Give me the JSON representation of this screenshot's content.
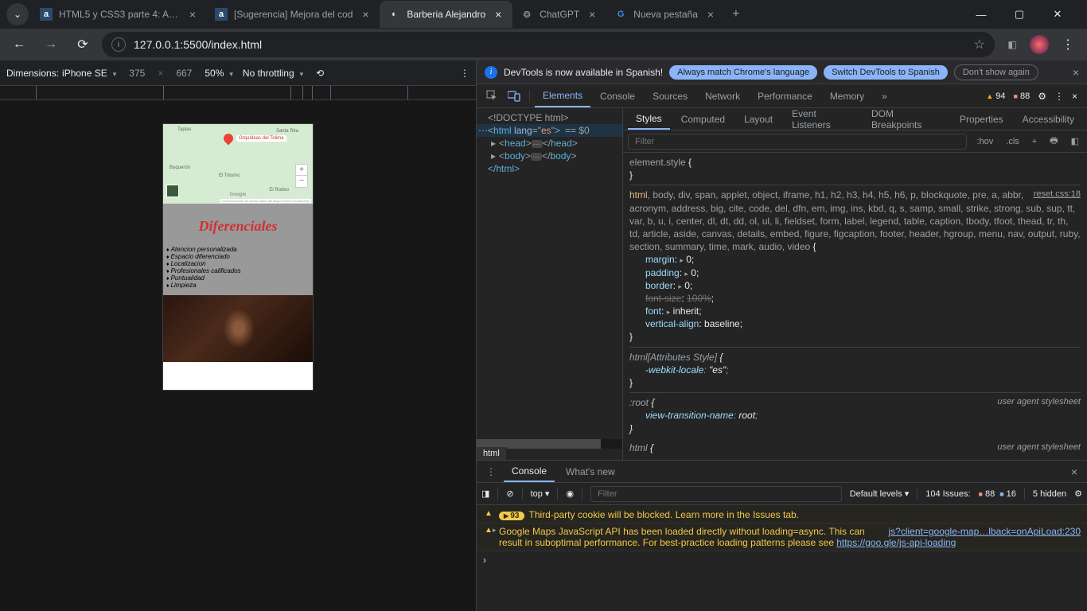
{
  "tabs": [
    {
      "title": "HTML5 y CSS3 parte 4: Avan",
      "favicon": "a"
    },
    {
      "title": "[Sugerencia] Mejora del cod",
      "favicon": "a"
    },
    {
      "title": "Barberia Alejandro",
      "favicon": "◐",
      "active": true
    },
    {
      "title": "ChatGPT",
      "favicon": "❂"
    },
    {
      "title": "Nueva pestaña",
      "favicon": "G"
    }
  ],
  "address": {
    "url": "127.0.0.1:5500/index.html"
  },
  "deviceBar": {
    "dimensions_label": "Dimensions:",
    "device": "iPhone SE",
    "width": "375",
    "height": "667",
    "zoom": "50%",
    "throttling": "No throttling"
  },
  "page": {
    "map": {
      "pin_label": "Orquídeas del Tolima",
      "labels": [
        "Tapias",
        "Santa Rita",
        "Boquerón",
        "El Totumo",
        "El Rodeo"
      ],
      "logo": "Google",
      "attrib": "Combinaciones de teclas   Datos del mapa ©2024   Condiciones"
    },
    "section_title": "Diferenciales",
    "items": [
      "Atencion personalizada",
      "Espacio diferenciado",
      "Localizacion",
      "Profesionales calificados",
      "Puntualidad",
      "Limpieza"
    ]
  },
  "infobar": {
    "text": "DevTools is now available in Spanish!",
    "btn1": "Always match Chrome's language",
    "btn2": "Switch DevTools to Spanish",
    "btn3": "Don't show again"
  },
  "dtTabs": [
    "Elements",
    "Console",
    "Sources",
    "Network",
    "Performance",
    "Memory"
  ],
  "dtBadges": {
    "warn": "94",
    "err": "88"
  },
  "elements": {
    "doctype": "<!DOCTYPE html>",
    "html_open": "html",
    "lang_attr": "lang",
    "lang_val": "es",
    "eq": "== $0",
    "head": "head",
    "body": "body",
    "html_close": "</html>",
    "crumb": "html"
  },
  "stylesTabs": [
    "Styles",
    "Computed",
    "Layout",
    "Event Listeners",
    "DOM Breakpoints",
    "Properties",
    "Accessibility"
  ],
  "stylesToolbar": {
    "filter_ph": "Filter",
    "hov": ":hov",
    "cls": ".cls"
  },
  "styles": {
    "r0": {
      "sel": "element.style"
    },
    "r1": {
      "src": "reset.css:18",
      "selectors": "html, body, div, span, applet, object, iframe, h1, h2, h3, h4, h5, h6, p, blockquote, pre, a, abbr, acronym, address, big, cite, code, del, dfn, em, img, ins, kbd, q, s, samp, small, strike, strong, sub, sup, tt, var, b, u, i, center, dl, dt, dd, ol, ul, li, fieldset, form, label, legend, table, caption, tbody, tfoot, thead, tr, th, td, article, aside, canvas, details, embed, figure, figcaption, footer, header, hgroup, menu, nav, output, ruby, section, summary, time, mark, audio, video",
      "props": [
        {
          "n": "margin",
          "v": "0",
          "tri": true
        },
        {
          "n": "padding",
          "v": "0",
          "tri": true
        },
        {
          "n": "border",
          "v": "0",
          "tri": true
        },
        {
          "n": "font-size",
          "v": "100%",
          "struck": true
        },
        {
          "n": "font",
          "v": "inherit",
          "tri": true
        },
        {
          "n": "vertical-align",
          "v": "baseline"
        }
      ]
    },
    "r2": {
      "sel": "html[Attributes Style]",
      "props": [
        {
          "n": "-webkit-locale",
          "v": "\"es\""
        }
      ]
    },
    "r3": {
      "sel": ":root",
      "src": "user agent stylesheet",
      "props": [
        {
          "n": "view-transition-name",
          "v": "root"
        }
      ]
    },
    "r4": {
      "sel": "html",
      "src": "user agent stylesheet"
    }
  },
  "drawerTabs": [
    "Console",
    "What's new"
  ],
  "consoleToolbar": {
    "context": "top",
    "filter_ph": "Filter",
    "levels": "Default levels",
    "issues_label": "104 Issues:",
    "issues_err": "88",
    "issues_info": "16",
    "hidden": "5 hidden"
  },
  "console": {
    "line1": {
      "badge": "93",
      "text": "Third-party cookie will be blocked. Learn more in the Issues tab."
    },
    "line2": {
      "text": "Google Maps JavaScript API has been loaded directly without loading=async. This can result in suboptimal performance. For best-practice loading patterns please see ",
      "link_right": "js?client=google-map…lback=onApiLoad:230",
      "link_inline": "https://goo.gle/js-api-loading"
    }
  }
}
